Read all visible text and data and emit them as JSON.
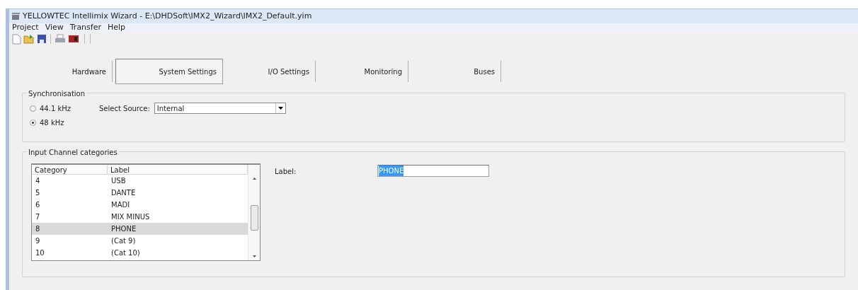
{
  "window": {
    "title": "YELLOWTEC Intellimix Wizard - E:\\DHDSoft\\IMX2_Wizard\\IMX2_Default.yim"
  },
  "menu": [
    "Project",
    "View",
    "Transfer",
    "Help"
  ],
  "tabs": [
    {
      "label": "Hardware",
      "selected": false
    },
    {
      "label": "System Settings",
      "selected": true
    },
    {
      "label": "I/O Settings",
      "selected": false
    },
    {
      "label": "Monitoring",
      "selected": false
    },
    {
      "label": "Buses",
      "selected": false
    }
  ],
  "synchronisation": {
    "title": "Synchronisation",
    "rates": [
      {
        "label": "44.1 kHz",
        "selected": false
      },
      {
        "label": "48 kHz",
        "selected": true
      }
    ],
    "source_label": "Select Source:",
    "source_value": "Internal"
  },
  "categories": {
    "title": "Input Channel categories",
    "columns": [
      "Category",
      "Label"
    ],
    "rows": [
      {
        "category": "4",
        "label": "USB",
        "selected": false
      },
      {
        "category": "5",
        "label": "DANTE",
        "selected": false
      },
      {
        "category": "6",
        "label": "MADI",
        "selected": false
      },
      {
        "category": "7",
        "label": "MIX MINUS",
        "selected": false
      },
      {
        "category": "8",
        "label": "PHONE",
        "selected": true
      },
      {
        "category": "9",
        "label": "(Cat 9)",
        "selected": false
      },
      {
        "category": "10",
        "label": "(Cat 10)",
        "selected": false
      }
    ],
    "field_label": "Label:",
    "field_value": "PHONE"
  }
}
